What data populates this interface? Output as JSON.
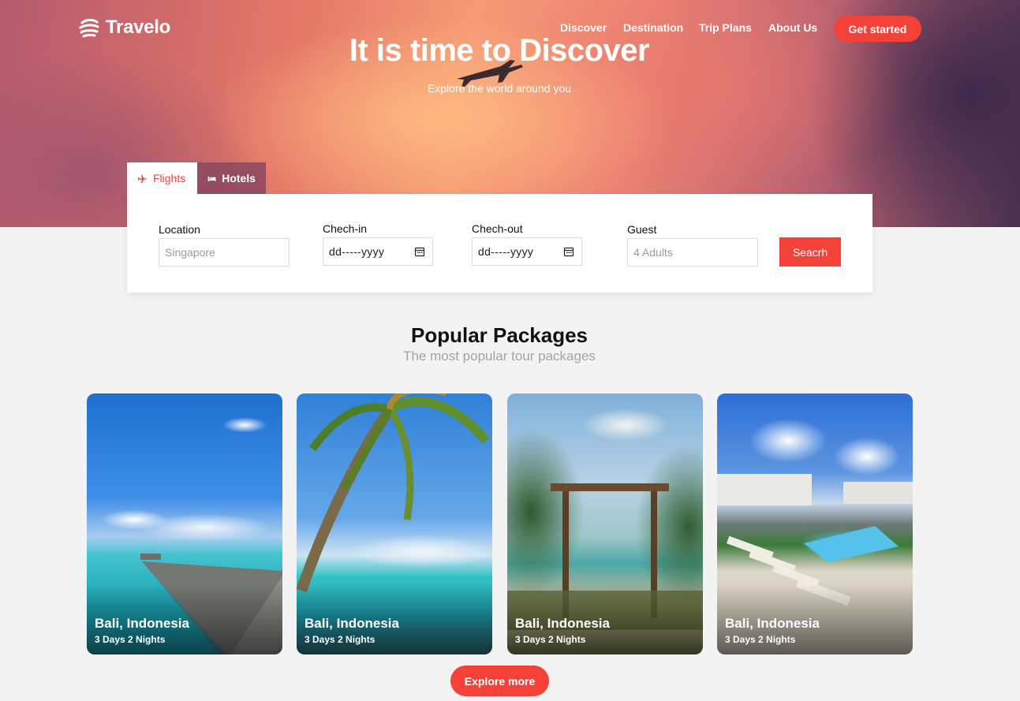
{
  "brand": {
    "name": "Travelo"
  },
  "nav": {
    "links": [
      "Discover",
      "Destination",
      "Trip Plans",
      "About Us"
    ],
    "cta": "Get started"
  },
  "hero": {
    "title_prefix": "It is time to ",
    "title_emphasis": "Discover",
    "subtitle": "Explore the world around you"
  },
  "search": {
    "tabs": [
      {
        "label": "Flights",
        "icon": "plane-icon",
        "active": true
      },
      {
        "label": "Hotels",
        "icon": "bed-icon",
        "active": false
      }
    ],
    "location": {
      "label": "Location",
      "placeholder": "Singapore"
    },
    "checkin": {
      "label": "Chech-in",
      "value": "dd-----yyyy"
    },
    "checkout": {
      "label": "Chech-out",
      "value": "dd-----yyyy"
    },
    "guest": {
      "label": "Guest",
      "placeholder": "4 Adults"
    },
    "button": "Seacrh"
  },
  "packages": {
    "title": "Popular Packages",
    "subtitle": "The most popular tour packages",
    "items": [
      {
        "title": "Bali, Indonesia",
        "meta": "3 Days 2 Nights"
      },
      {
        "title": "Bali, Indonesia",
        "meta": "3 Days 2 Nights"
      },
      {
        "title": "Bali, Indonesia",
        "meta": "3 Days 2 Nights"
      },
      {
        "title": "Bali, Indonesia",
        "meta": "3 Days 2 Nights"
      }
    ],
    "more_button": "Explore more"
  },
  "colors": {
    "accent": "#f44239",
    "muted_text": "#a3a3a3"
  }
}
